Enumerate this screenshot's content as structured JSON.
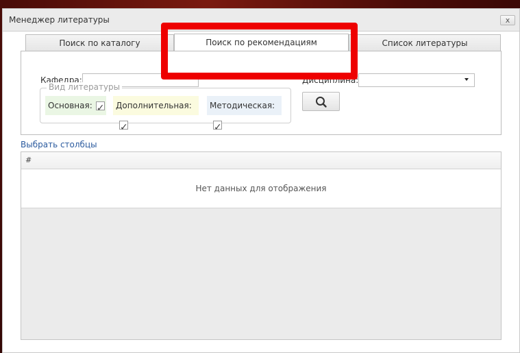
{
  "window": {
    "title": "Менеджер литературы",
    "close_label": "x"
  },
  "tabs": [
    {
      "label": "Поиск по каталогу",
      "active": false
    },
    {
      "label": "Поиск по рекомендациям",
      "active": true
    },
    {
      "label": "Список литературы",
      "active": false
    }
  ],
  "filters": {
    "department_label": "Кафедра:",
    "department_value": "",
    "discipline_label": "Дисциплина:",
    "discipline_value": "",
    "literature_type_legend": "Вид литературы",
    "types": [
      {
        "label": "Основная:",
        "checked": true,
        "bg": "#eaf6e4"
      },
      {
        "label": "Дополнительная:",
        "checked": true,
        "bg": "#fbfbdf"
      },
      {
        "label": "Методическая:",
        "checked": true,
        "bg": "#eaf1f8"
      }
    ],
    "search_icon": "search-icon"
  },
  "grid": {
    "choose_columns_link": "Выбрать столбцы",
    "columns": [
      "#"
    ],
    "empty_text": "Нет данных для отображения"
  },
  "highlight_color": "#ee0000"
}
